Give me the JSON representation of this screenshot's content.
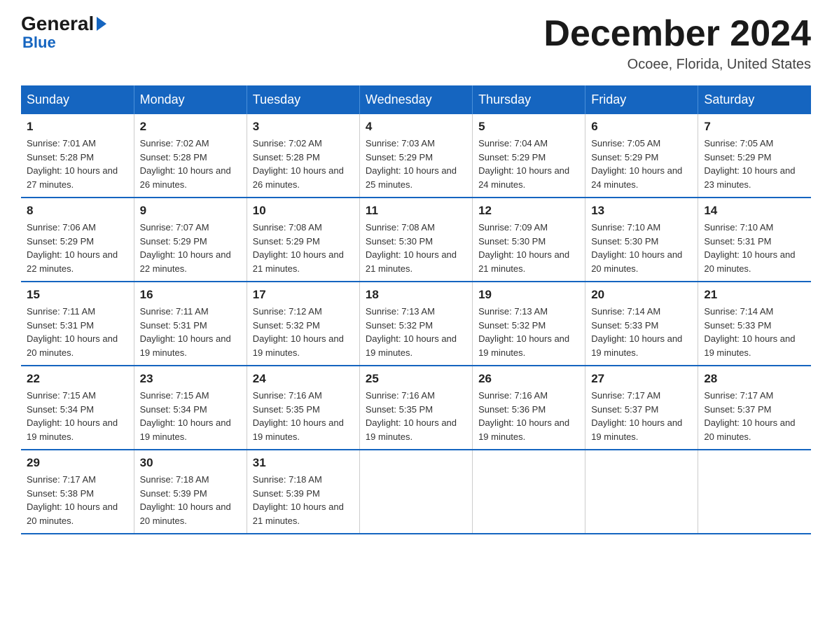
{
  "logo": {
    "general": "General",
    "arrow": "►",
    "blue": "Blue"
  },
  "title": "December 2024",
  "location": "Ocoee, Florida, United States",
  "days_of_week": [
    "Sunday",
    "Monday",
    "Tuesday",
    "Wednesday",
    "Thursday",
    "Friday",
    "Saturday"
  ],
  "weeks": [
    [
      {
        "day": "1",
        "sunrise": "7:01 AM",
        "sunset": "5:28 PM",
        "daylight": "10 hours and 27 minutes."
      },
      {
        "day": "2",
        "sunrise": "7:02 AM",
        "sunset": "5:28 PM",
        "daylight": "10 hours and 26 minutes."
      },
      {
        "day": "3",
        "sunrise": "7:02 AM",
        "sunset": "5:28 PM",
        "daylight": "10 hours and 26 minutes."
      },
      {
        "day": "4",
        "sunrise": "7:03 AM",
        "sunset": "5:29 PM",
        "daylight": "10 hours and 25 minutes."
      },
      {
        "day": "5",
        "sunrise": "7:04 AM",
        "sunset": "5:29 PM",
        "daylight": "10 hours and 24 minutes."
      },
      {
        "day": "6",
        "sunrise": "7:05 AM",
        "sunset": "5:29 PM",
        "daylight": "10 hours and 24 minutes."
      },
      {
        "day": "7",
        "sunrise": "7:05 AM",
        "sunset": "5:29 PM",
        "daylight": "10 hours and 23 minutes."
      }
    ],
    [
      {
        "day": "8",
        "sunrise": "7:06 AM",
        "sunset": "5:29 PM",
        "daylight": "10 hours and 22 minutes."
      },
      {
        "day": "9",
        "sunrise": "7:07 AM",
        "sunset": "5:29 PM",
        "daylight": "10 hours and 22 minutes."
      },
      {
        "day": "10",
        "sunrise": "7:08 AM",
        "sunset": "5:29 PM",
        "daylight": "10 hours and 21 minutes."
      },
      {
        "day": "11",
        "sunrise": "7:08 AM",
        "sunset": "5:30 PM",
        "daylight": "10 hours and 21 minutes."
      },
      {
        "day": "12",
        "sunrise": "7:09 AM",
        "sunset": "5:30 PM",
        "daylight": "10 hours and 21 minutes."
      },
      {
        "day": "13",
        "sunrise": "7:10 AM",
        "sunset": "5:30 PM",
        "daylight": "10 hours and 20 minutes."
      },
      {
        "day": "14",
        "sunrise": "7:10 AM",
        "sunset": "5:31 PM",
        "daylight": "10 hours and 20 minutes."
      }
    ],
    [
      {
        "day": "15",
        "sunrise": "7:11 AM",
        "sunset": "5:31 PM",
        "daylight": "10 hours and 20 minutes."
      },
      {
        "day": "16",
        "sunrise": "7:11 AM",
        "sunset": "5:31 PM",
        "daylight": "10 hours and 19 minutes."
      },
      {
        "day": "17",
        "sunrise": "7:12 AM",
        "sunset": "5:32 PM",
        "daylight": "10 hours and 19 minutes."
      },
      {
        "day": "18",
        "sunrise": "7:13 AM",
        "sunset": "5:32 PM",
        "daylight": "10 hours and 19 minutes."
      },
      {
        "day": "19",
        "sunrise": "7:13 AM",
        "sunset": "5:32 PM",
        "daylight": "10 hours and 19 minutes."
      },
      {
        "day": "20",
        "sunrise": "7:14 AM",
        "sunset": "5:33 PM",
        "daylight": "10 hours and 19 minutes."
      },
      {
        "day": "21",
        "sunrise": "7:14 AM",
        "sunset": "5:33 PM",
        "daylight": "10 hours and 19 minutes."
      }
    ],
    [
      {
        "day": "22",
        "sunrise": "7:15 AM",
        "sunset": "5:34 PM",
        "daylight": "10 hours and 19 minutes."
      },
      {
        "day": "23",
        "sunrise": "7:15 AM",
        "sunset": "5:34 PM",
        "daylight": "10 hours and 19 minutes."
      },
      {
        "day": "24",
        "sunrise": "7:16 AM",
        "sunset": "5:35 PM",
        "daylight": "10 hours and 19 minutes."
      },
      {
        "day": "25",
        "sunrise": "7:16 AM",
        "sunset": "5:35 PM",
        "daylight": "10 hours and 19 minutes."
      },
      {
        "day": "26",
        "sunrise": "7:16 AM",
        "sunset": "5:36 PM",
        "daylight": "10 hours and 19 minutes."
      },
      {
        "day": "27",
        "sunrise": "7:17 AM",
        "sunset": "5:37 PM",
        "daylight": "10 hours and 19 minutes."
      },
      {
        "day": "28",
        "sunrise": "7:17 AM",
        "sunset": "5:37 PM",
        "daylight": "10 hours and 20 minutes."
      }
    ],
    [
      {
        "day": "29",
        "sunrise": "7:17 AM",
        "sunset": "5:38 PM",
        "daylight": "10 hours and 20 minutes."
      },
      {
        "day": "30",
        "sunrise": "7:18 AM",
        "sunset": "5:39 PM",
        "daylight": "10 hours and 20 minutes."
      },
      {
        "day": "31",
        "sunrise": "7:18 AM",
        "sunset": "5:39 PM",
        "daylight": "10 hours and 21 minutes."
      },
      null,
      null,
      null,
      null
    ]
  ],
  "labels": {
    "sunrise": "Sunrise:",
    "sunset": "Sunset:",
    "daylight": "Daylight:"
  }
}
